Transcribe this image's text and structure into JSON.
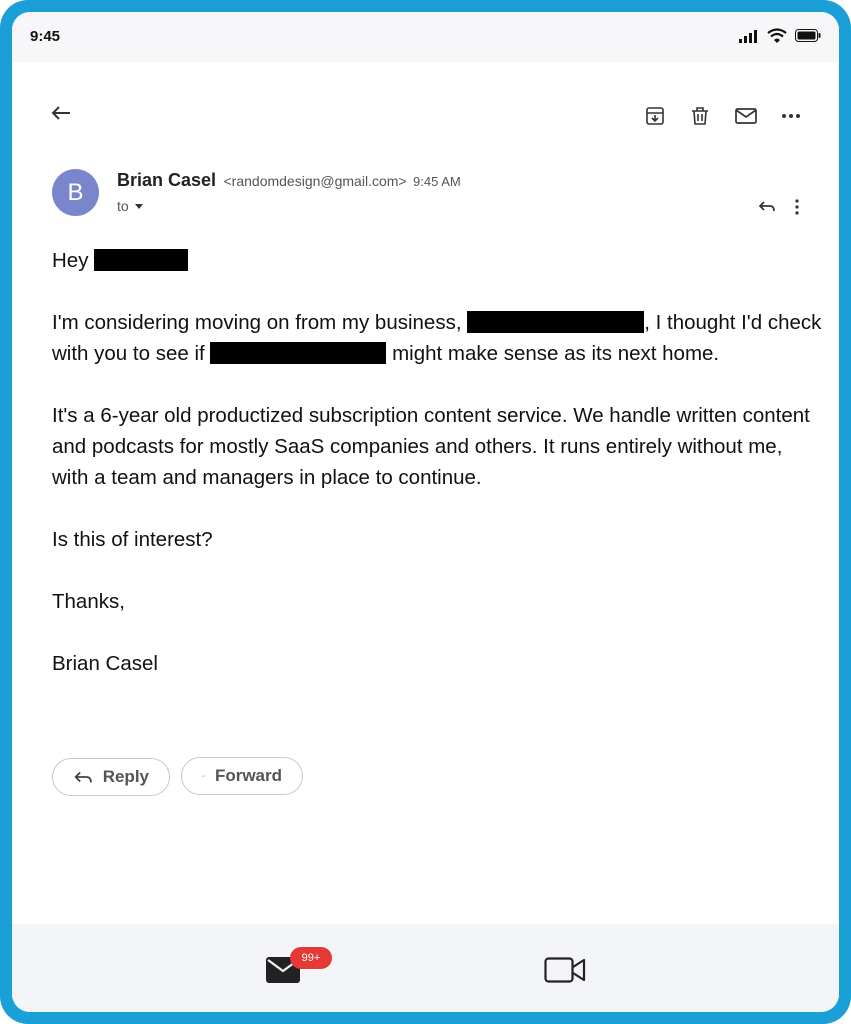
{
  "status_bar": {
    "time": "9:45"
  },
  "email": {
    "sender_initial": "B",
    "sender_name": "Brian Casel",
    "sender_email": "<randomdesign@gmail.com>",
    "time": "9:45 AM",
    "to_label": "to",
    "greeting": "Hey",
    "para1_a": "I'm considering moving on from my business,",
    "para1_b": ", I thought I'd check with you to see if",
    "para1_c": "might make sense as its next home.",
    "para2": "It's a 6-year old productized subscription content service. We handle written content and podcasts for mostly SaaS companies and others. It runs entirely without me, with a team and managers in place to continue.",
    "para3": "Is this of interest?",
    "para4": "Thanks,",
    "signature": "Brian Casel"
  },
  "actions": {
    "reply_label": "Reply",
    "forward_label": "Forward"
  },
  "bottom_nav": {
    "mail_badge": "99+"
  },
  "colors": {
    "frame": "#1a9fd6",
    "avatar": "#7986cb",
    "badge": "#e53935"
  }
}
